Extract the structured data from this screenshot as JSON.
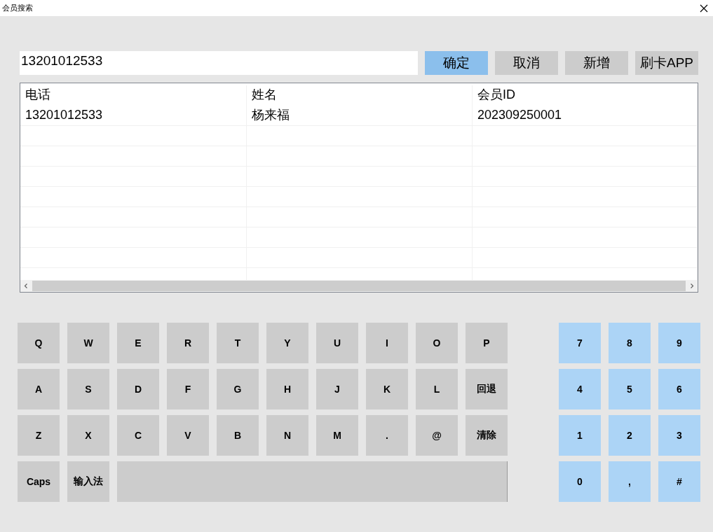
{
  "window": {
    "title": "会员搜索"
  },
  "search": {
    "value": "13201012533"
  },
  "buttons": [
    {
      "label": "确定",
      "kind": "primary"
    },
    {
      "label": "取消",
      "kind": "normal"
    },
    {
      "label": "新增",
      "kind": "normal"
    },
    {
      "label": "刷卡APP",
      "kind": "normal"
    }
  ],
  "table": {
    "columns": [
      "电话",
      "姓名",
      "会员ID"
    ],
    "rows": [
      [
        "13201012533",
        "杨来福",
        "202309250001"
      ]
    ]
  },
  "keyboard": {
    "rows": [
      [
        {
          "label": "Q",
          "kind": "key"
        },
        {
          "label": "W",
          "kind": "key"
        },
        {
          "label": "E",
          "kind": "key"
        },
        {
          "label": "R",
          "kind": "key"
        },
        {
          "label": "T",
          "kind": "key"
        },
        {
          "label": "Y",
          "kind": "key"
        },
        {
          "label": "U",
          "kind": "key"
        },
        {
          "label": "I",
          "kind": "key"
        },
        {
          "label": "O",
          "kind": "key"
        },
        {
          "label": "P",
          "kind": "key"
        }
      ],
      [
        {
          "label": "A",
          "kind": "key"
        },
        {
          "label": "S",
          "kind": "key"
        },
        {
          "label": "D",
          "kind": "key"
        },
        {
          "label": "F",
          "kind": "key"
        },
        {
          "label": "G",
          "kind": "key"
        },
        {
          "label": "H",
          "kind": "key"
        },
        {
          "label": "J",
          "kind": "key"
        },
        {
          "label": "K",
          "kind": "key"
        },
        {
          "label": "L",
          "kind": "key"
        },
        {
          "label": "回退",
          "kind": "key"
        }
      ],
      [
        {
          "label": "Z",
          "kind": "key"
        },
        {
          "label": "X",
          "kind": "key"
        },
        {
          "label": "C",
          "kind": "key"
        },
        {
          "label": "V",
          "kind": "key"
        },
        {
          "label": "B",
          "kind": "key"
        },
        {
          "label": "N",
          "kind": "key"
        },
        {
          "label": "M",
          "kind": "key"
        },
        {
          "label": ".",
          "kind": "key"
        },
        {
          "label": "@",
          "kind": "key"
        },
        {
          "label": "清除",
          "kind": "key"
        }
      ],
      [
        {
          "label": "Caps",
          "kind": "key"
        },
        {
          "label": "输入法",
          "kind": "key"
        },
        {
          "kind": "space"
        }
      ]
    ]
  },
  "numpad": [
    "7",
    "8",
    "9",
    "4",
    "5",
    "6",
    "1",
    "2",
    "3",
    "0",
    ",",
    "#"
  ]
}
